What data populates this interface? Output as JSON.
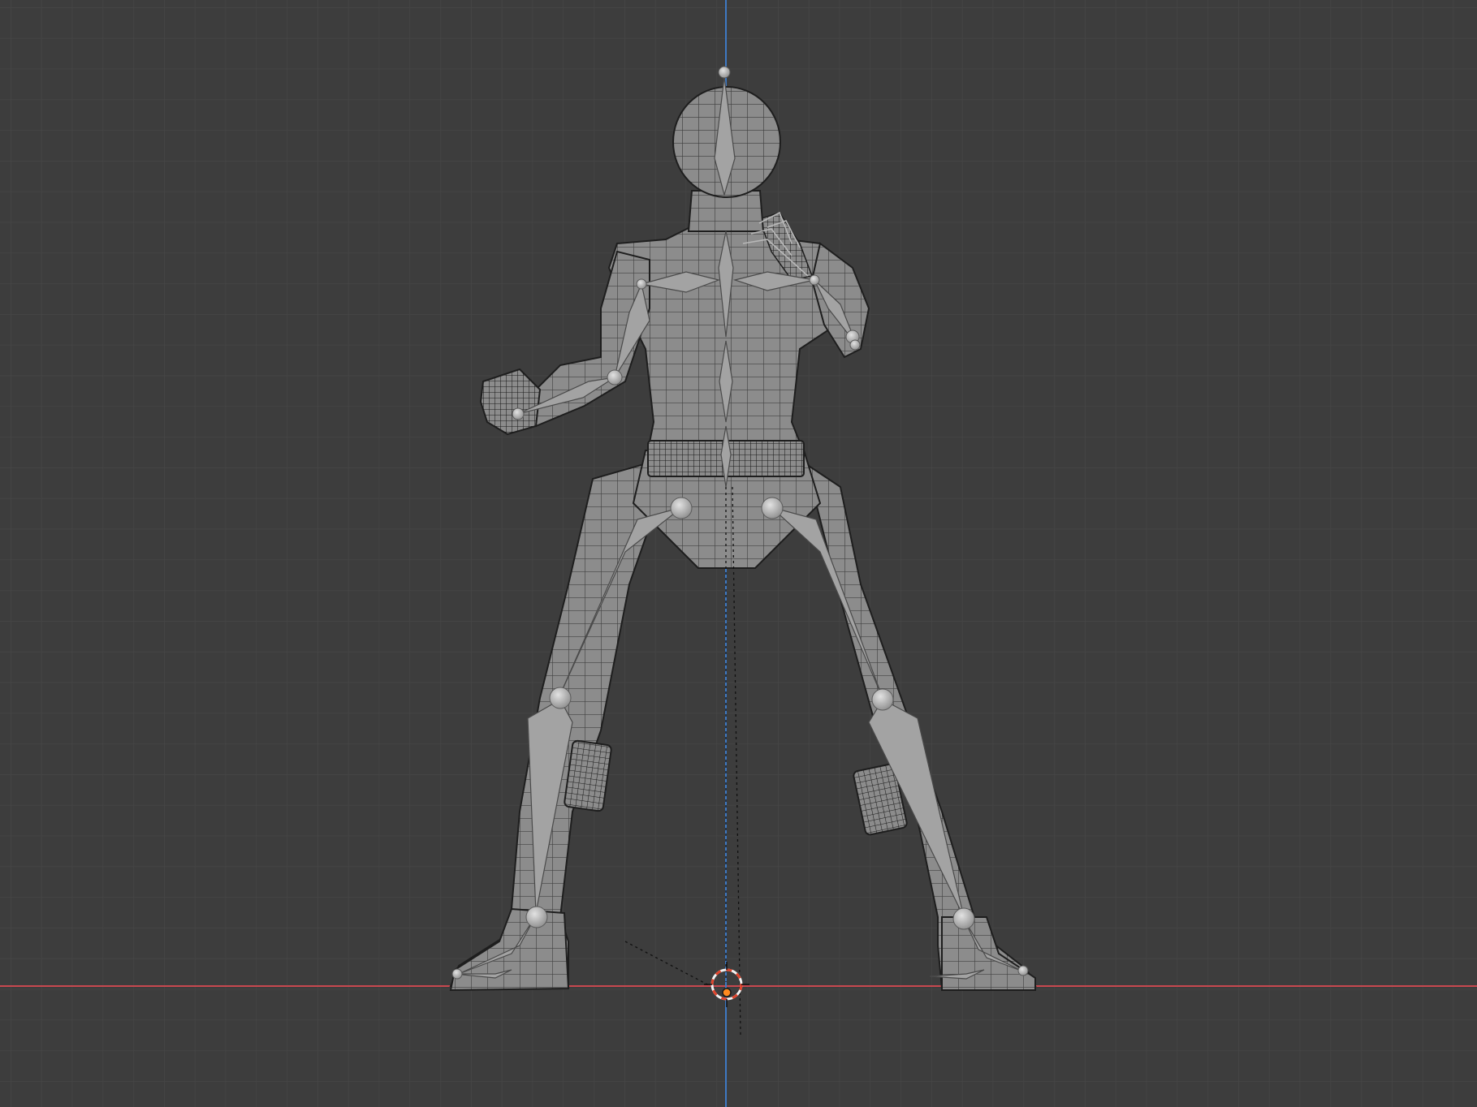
{
  "viewport": {
    "view": "front-orthographic",
    "object": "armature-with-character-mesh",
    "shading": "solid-wireframe-overlay"
  },
  "colors": {
    "background": "#3d3d3d",
    "grid_minor": "#4a4a4a",
    "x_axis": "#c8484f",
    "z_axis": "#3e79c3",
    "mesh_fill": "#8c8c8c",
    "mesh_wire": "#1e1e1e",
    "bone": "#a6a6a6",
    "cursor_red": "#e0442c",
    "cursor_white": "#f2f2f2",
    "origin": "#ff8a1f"
  },
  "icons": {
    "cursor": "3d-cursor-icon",
    "origin": "origin-dot-icon"
  }
}
